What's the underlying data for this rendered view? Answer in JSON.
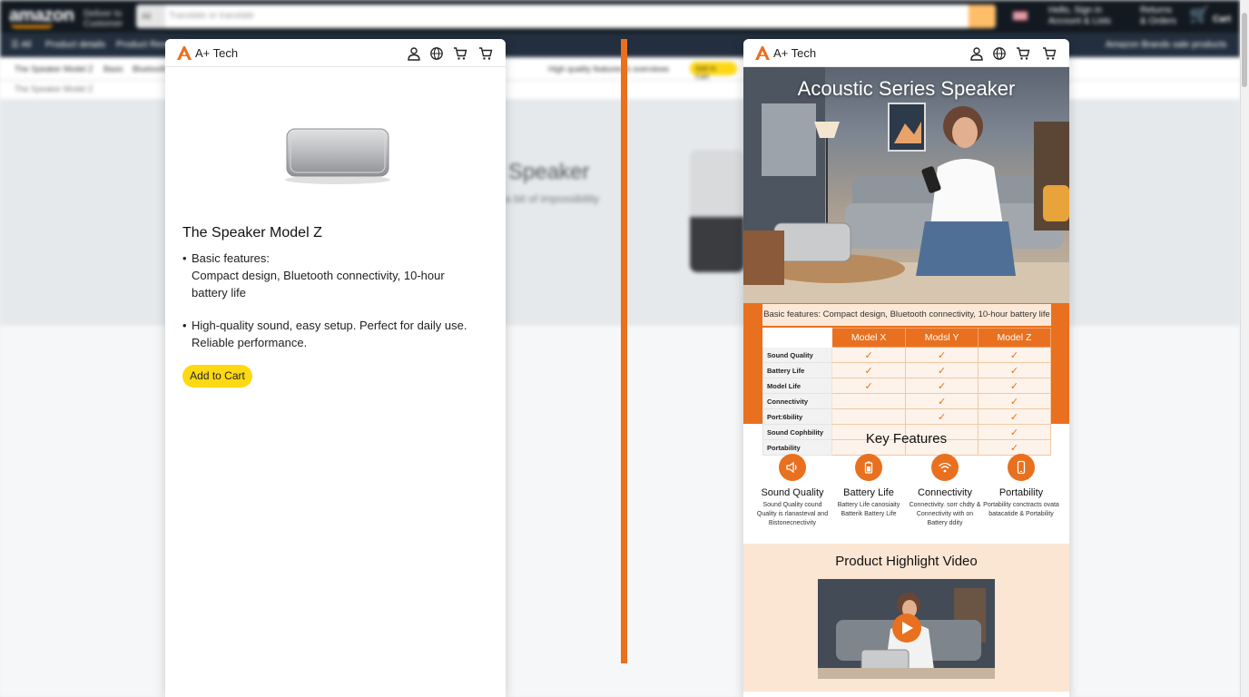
{
  "background": {
    "logo_text": "amazon",
    "deliver_line1": "Deliver to",
    "deliver_line2": "Customer",
    "search_category": "All",
    "search_placeholder": "Translate or translate",
    "account_line1": "Hello, Sign in",
    "account_line2": "Account & Lists",
    "returns_line1": "Returns",
    "returns_line2": "& Orders",
    "cart_label": "Cart",
    "nav_all": "All",
    "nav_items": [
      "Product details",
      "Product Reviews"
    ],
    "right_nav_text": "Amazon Brands sale products",
    "sub_items": [
      "The Speaker Model Z",
      "Basic",
      "Bluetooth"
    ],
    "sub_item_mid": "High quality features & overviews",
    "sub_pill": "Add to Cart",
    "breadcrumb": "The Speaker Model Z",
    "hero_title": "Speaker",
    "hero_sub": "a bit of impossibility"
  },
  "left_panel": {
    "brand": "A+ Tech",
    "product_title": "The Speaker Model Z",
    "bullet1_label": "Basic features:",
    "bullet1_text": "Compact design, Bluetooth connectivity, 10-hour battery life",
    "bullet2_text": "High-quality sound, easy setup. Perfect for daily use. Reliable performance.",
    "add_to_cart": "Add to Cart"
  },
  "right_panel": {
    "brand": "A+ Tech",
    "hero_title": "Acoustic Series Speaker",
    "features_strip": "Basic features: Compact design, Bluetooth connectivity, 10-hour battery life",
    "comparison": {
      "columns": [
        "Model X",
        "Modsl Y",
        "Model Z"
      ],
      "rows": [
        {
          "label": "Sound Quality",
          "checks": [
            true,
            true,
            true
          ]
        },
        {
          "label": "Battery Life",
          "checks": [
            true,
            true,
            true
          ]
        },
        {
          "label": "Model Life",
          "checks": [
            true,
            true,
            true
          ]
        },
        {
          "label": "Connectivity",
          "checks": [
            false,
            true,
            true
          ]
        },
        {
          "label": "Port:6bility",
          "checks": [
            false,
            true,
            true
          ]
        },
        {
          "label": "Sound Cophbility",
          "checks": [
            false,
            false,
            true
          ]
        },
        {
          "label": "Portability",
          "checks": [
            false,
            false,
            true
          ]
        }
      ]
    },
    "key_features_title": "Key Features",
    "key_features": [
      {
        "icon": "speaker-icon",
        "label": "Sound Quality",
        "desc": "Sound Quality cound Quality is rlanasteval and Bistonecnectivity"
      },
      {
        "icon": "battery-icon",
        "label": "Battery Life",
        "desc": "Battery Life canosiaity Batterik Battery Life"
      },
      {
        "icon": "wifi-icon",
        "label": "Connectivity",
        "desc": "Connectivity. sorr chdty & Connectivity with on Battery ddity"
      },
      {
        "icon": "phone-icon",
        "label": "Portability",
        "desc": "Portability conctracts ovata batacatide & Portability"
      }
    ],
    "video_title": "Product Highlight Video"
  },
  "colors": {
    "accent_orange": "#e8701f",
    "amazon_dark": "#131921",
    "amazon_nav": "#232f3e",
    "cart_yellow": "#ffd814"
  }
}
